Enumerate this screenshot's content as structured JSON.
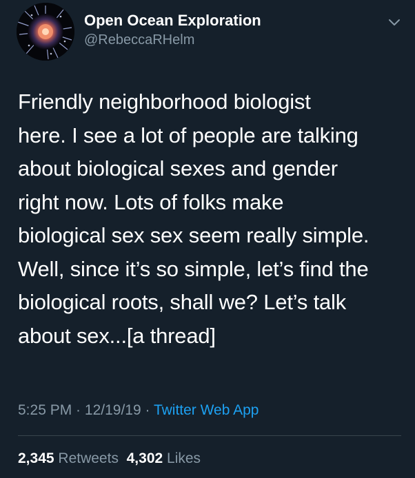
{
  "tweet": {
    "author": {
      "display_name": "Open Ocean Exploration",
      "handle": "@RebeccaRHelm"
    },
    "text_lines": [
      "Friendly neighborhood biologist",
      "here. I see a lot of people are talking",
      "about biological sexes and gender",
      "right now. Lots of folks make",
      "biological sex sex seem really simple.",
      "Well, since it’s so simple, let’s find the",
      "biological roots, shall we?  Let’s talk",
      "about sex...[a thread]"
    ],
    "time": "5:25 PM",
    "separator": " · ",
    "date": "12/19/19",
    "source": "Twitter Web App",
    "retweets_count": "2,345",
    "retweets_label": "Retweets",
    "likes_count": "4,302",
    "likes_label": "Likes"
  },
  "icons": {
    "avatar": "jellyfish-avatar",
    "menu": "chevron-down-icon"
  },
  "colors": {
    "background": "#15202b",
    "text": "#ffffff",
    "secondary": "#8899a6",
    "link": "#1da1f2",
    "divider": "#38444d"
  }
}
